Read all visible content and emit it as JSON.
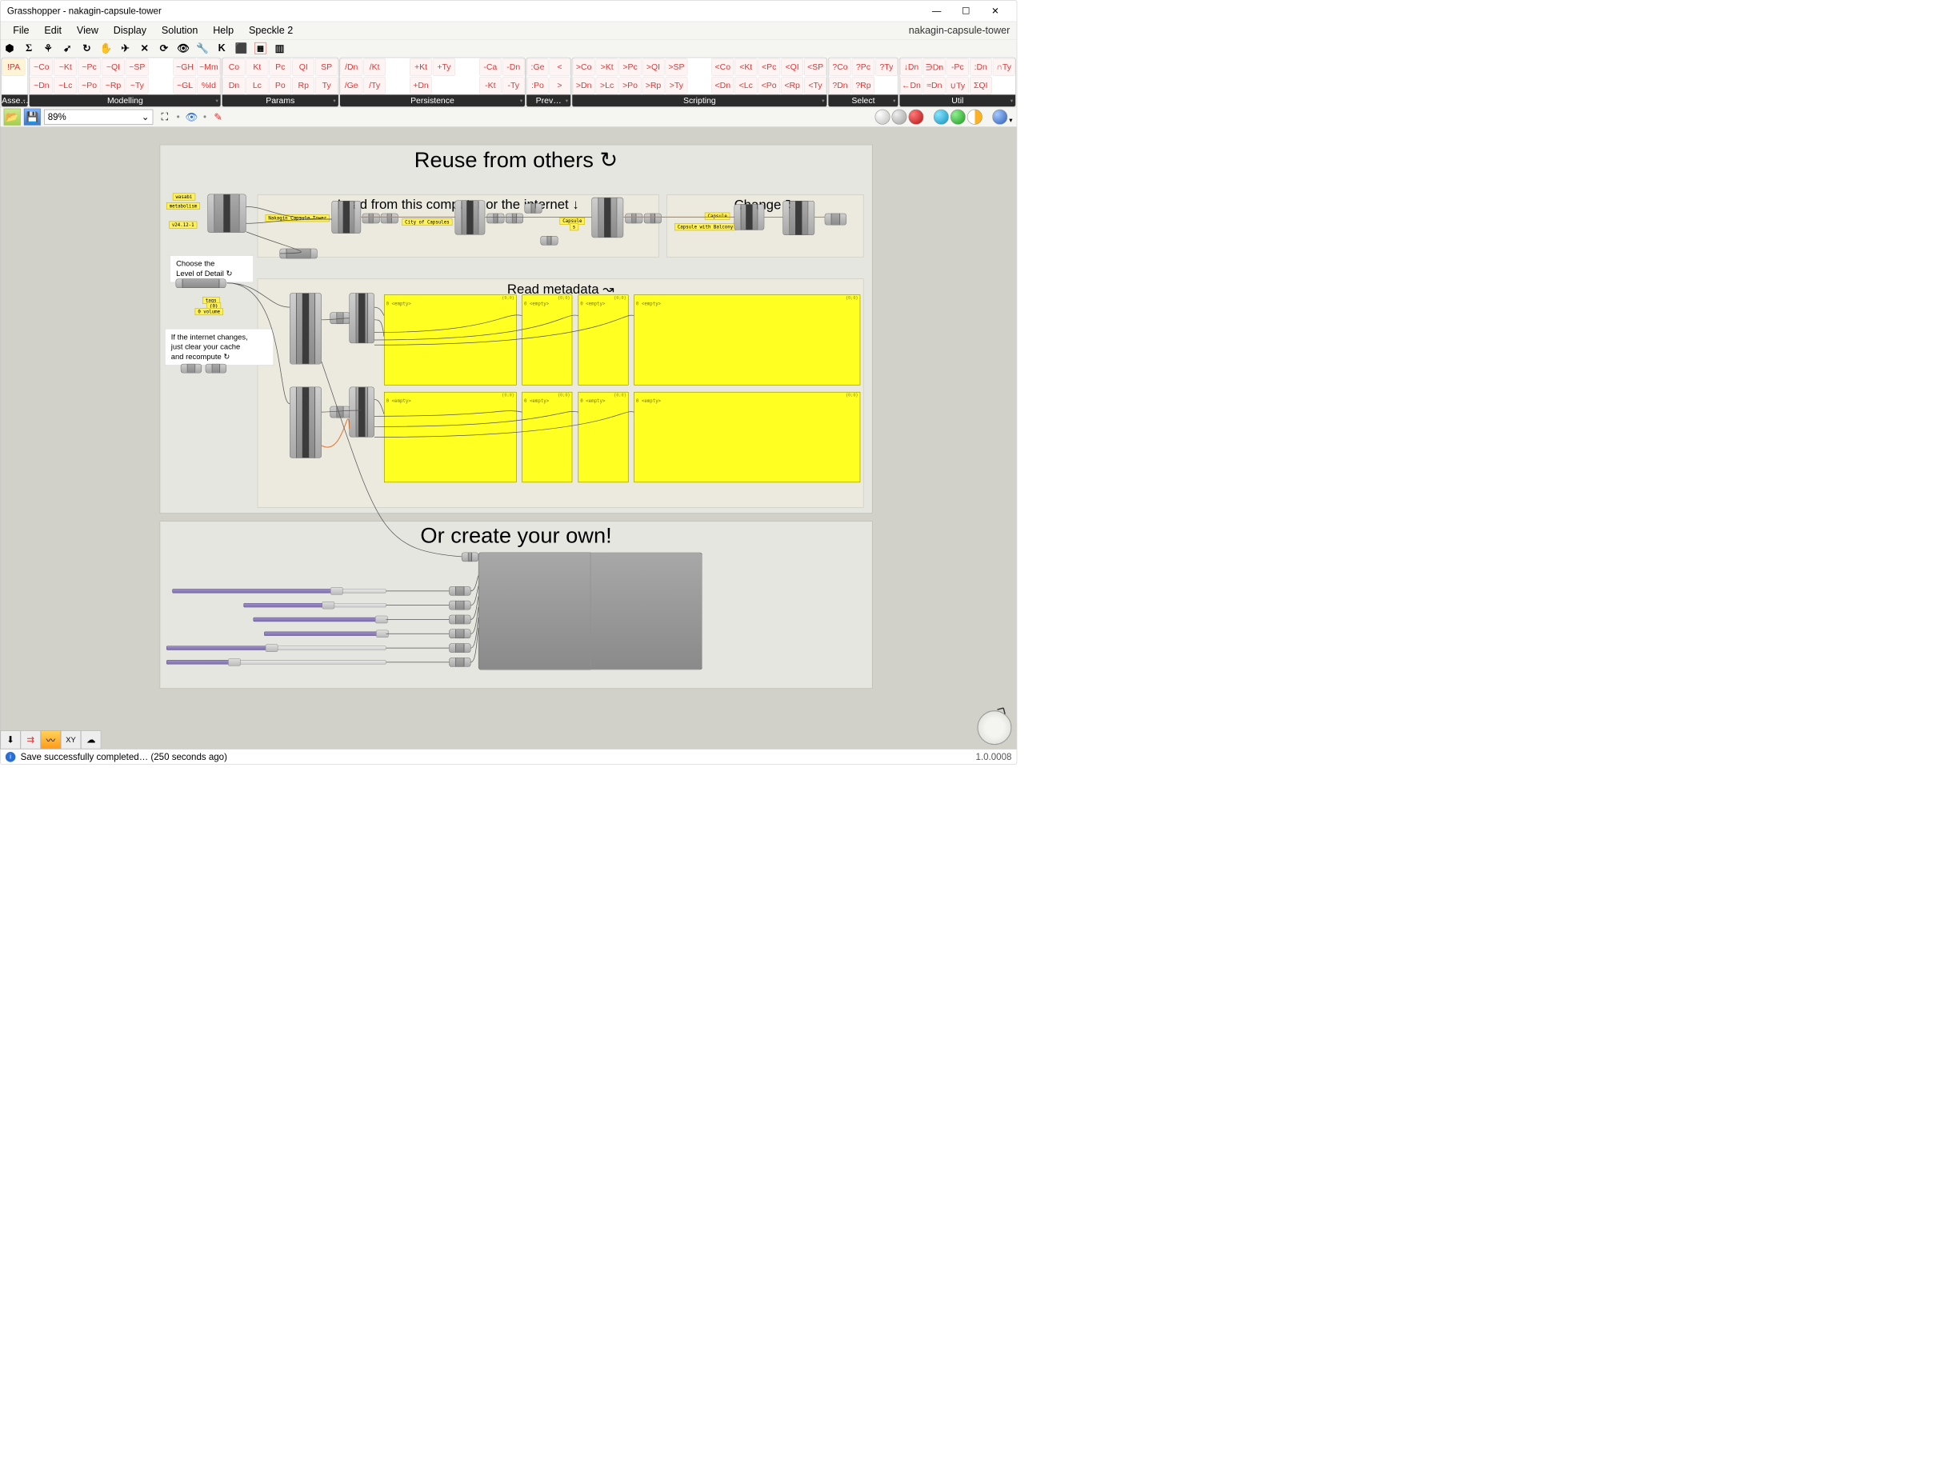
{
  "window": {
    "title": "Grasshopper - nakagin-capsule-tower",
    "doc_name": "nakagin-capsule-tower"
  },
  "menu": [
    "File",
    "Edit",
    "View",
    "Display",
    "Solution",
    "Help",
    "Speckle 2"
  ],
  "iconbar_glyphs": [
    "⬢",
    "Σ",
    "⚘",
    "➹",
    "↻",
    "✋",
    "✈",
    "✕",
    "⟳",
    "👁",
    "🔧",
    "K",
    "⬛",
    "▦",
    "▥"
  ],
  "ribbon": {
    "asse": {
      "title": "Asse…",
      "cell": "!PA"
    },
    "modelling": {
      "title": "Modelling",
      "r1": [
        "~Co",
        "~Kt",
        "~Pc",
        "~QI",
        "~SP",
        " ",
        "~GH",
        "~Mm"
      ],
      "r2": [
        "~Dn",
        "~Lc",
        "~Po",
        "~Rp",
        "~Ty",
        " ",
        "~GL",
        "%Id"
      ]
    },
    "params": {
      "title": "Params",
      "r1": [
        "Co",
        "Kt",
        "Pc",
        "QI",
        "SP"
      ],
      "r2": [
        "Dn",
        "Lc",
        "Po",
        "Rp",
        "Ty"
      ]
    },
    "persistence": {
      "title": "Persistence",
      "r1": [
        "/Dn",
        "/Kt",
        " ",
        "+Kt",
        "+Ty",
        " ",
        "-Ca",
        "-Dn"
      ],
      "r2": [
        "/Ge",
        "/Ty",
        " ",
        "+Dn",
        " ",
        " ",
        "-Kt",
        "-Ty"
      ]
    },
    "prev": {
      "title": "Prev…",
      "r1": [
        ":Ge",
        "<"
      ],
      "r2": [
        ":Po",
        ">"
      ]
    },
    "scripting": {
      "title": "Scripting",
      "r1": [
        ">Co",
        ">Kt",
        ">Pc",
        ">QI",
        ">SP",
        " ",
        "<Co",
        "<Kt",
        "<Pc",
        "<QI",
        "<SP"
      ],
      "r2": [
        ">Dn",
        ">Lc",
        ">Po",
        ">Rp",
        ">Ty",
        " ",
        "<Dn",
        "<Lc",
        "<Po",
        "<Rp",
        "<Ty"
      ]
    },
    "select": {
      "title": "Select",
      "r1": [
        "?Co",
        "?Pc",
        "?Ty"
      ],
      "r2": [
        "?Dn",
        "?Rp",
        " "
      ]
    },
    "util": {
      "title": "Util",
      "r1": [
        "↓Dn",
        "∋Dn",
        "-Pc",
        ":Dn",
        "∩Ty"
      ],
      "r2": [
        "←Dn",
        "≈Dn",
        "∪Ty",
        "ΣQI",
        " "
      ]
    }
  },
  "zoom": "89%",
  "canvas": {
    "main_title": "Reuse from others ↻",
    "load_title": "Load from this computer or the internet ↓",
    "change_title": "Change ↻",
    "meta_title": "Read metadata ↝",
    "create_title": "Or create your own!",
    "detail_note": "Choose the\nLevel of Detail ↻",
    "cache_note": "If the internet changes,\njust clear your cache\nand recompute ↻",
    "labels": {
      "wasabi": "wasabi",
      "metabolism": "metabolism",
      "v24": "v24.12-1",
      "ntower": "Nakagin Capsule Tower",
      "city": "City of Capsules",
      "capsule": "Capsule",
      "capsule_s": "s",
      "cap_only": "Capsule",
      "cap_balcony": "Capsule with Balcony",
      "tags": "tags",
      "tags0": "{0}",
      "tags_vol": "0 volume"
    },
    "panel_head": "{0;0}",
    "panel_empty": "0 <empty>"
  },
  "statusbar": {
    "message": "Save successfully completed… (250 seconds ago)",
    "version": "1.0.0008"
  }
}
